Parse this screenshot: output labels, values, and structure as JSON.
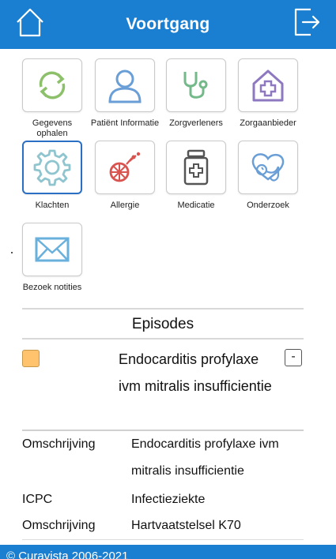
{
  "header": {
    "title": "Voortgang",
    "home_icon": "home-icon",
    "logout_icon": "logout-icon",
    "color": "#1b7fd1"
  },
  "tiles": [
    {
      "label": "Gegevens ophalen",
      "icon": "refresh-icon"
    },
    {
      "label": "Patiënt Informatie",
      "icon": "person-icon"
    },
    {
      "label": "Zorgverleners",
      "icon": "stethoscope-icon"
    },
    {
      "label": "Zorgaanbieder",
      "icon": "hospital-icon"
    },
    {
      "label": "Klachten",
      "icon": "gear-icon",
      "selected": true
    },
    {
      "label": "Allergie",
      "icon": "allergy-icon"
    },
    {
      "label": "Medicatie",
      "icon": "medication-icon"
    },
    {
      "label": "Onderzoek",
      "icon": "heart-stethoscope-icon"
    },
    {
      "label": "Bezoek notities",
      "icon": "mail-icon"
    }
  ],
  "episodes": {
    "heading": "Episodes",
    "item": {
      "title": "Endocarditis profylaxe ivm mitralis insufficientie",
      "swatch_color": "#ffc36e",
      "toggle": "-"
    },
    "details": [
      {
        "key": "Omschrijving",
        "value": "Endocarditis profylaxe ivm mitralis insufficientie"
      },
      {
        "key": "ICPC",
        "value": "Infectieziekte"
      },
      {
        "key": "Omschrijving",
        "value": "Hartvaatstelsel K70"
      }
    ]
  },
  "footer": {
    "text": "© Curavista 2006-2021"
  }
}
